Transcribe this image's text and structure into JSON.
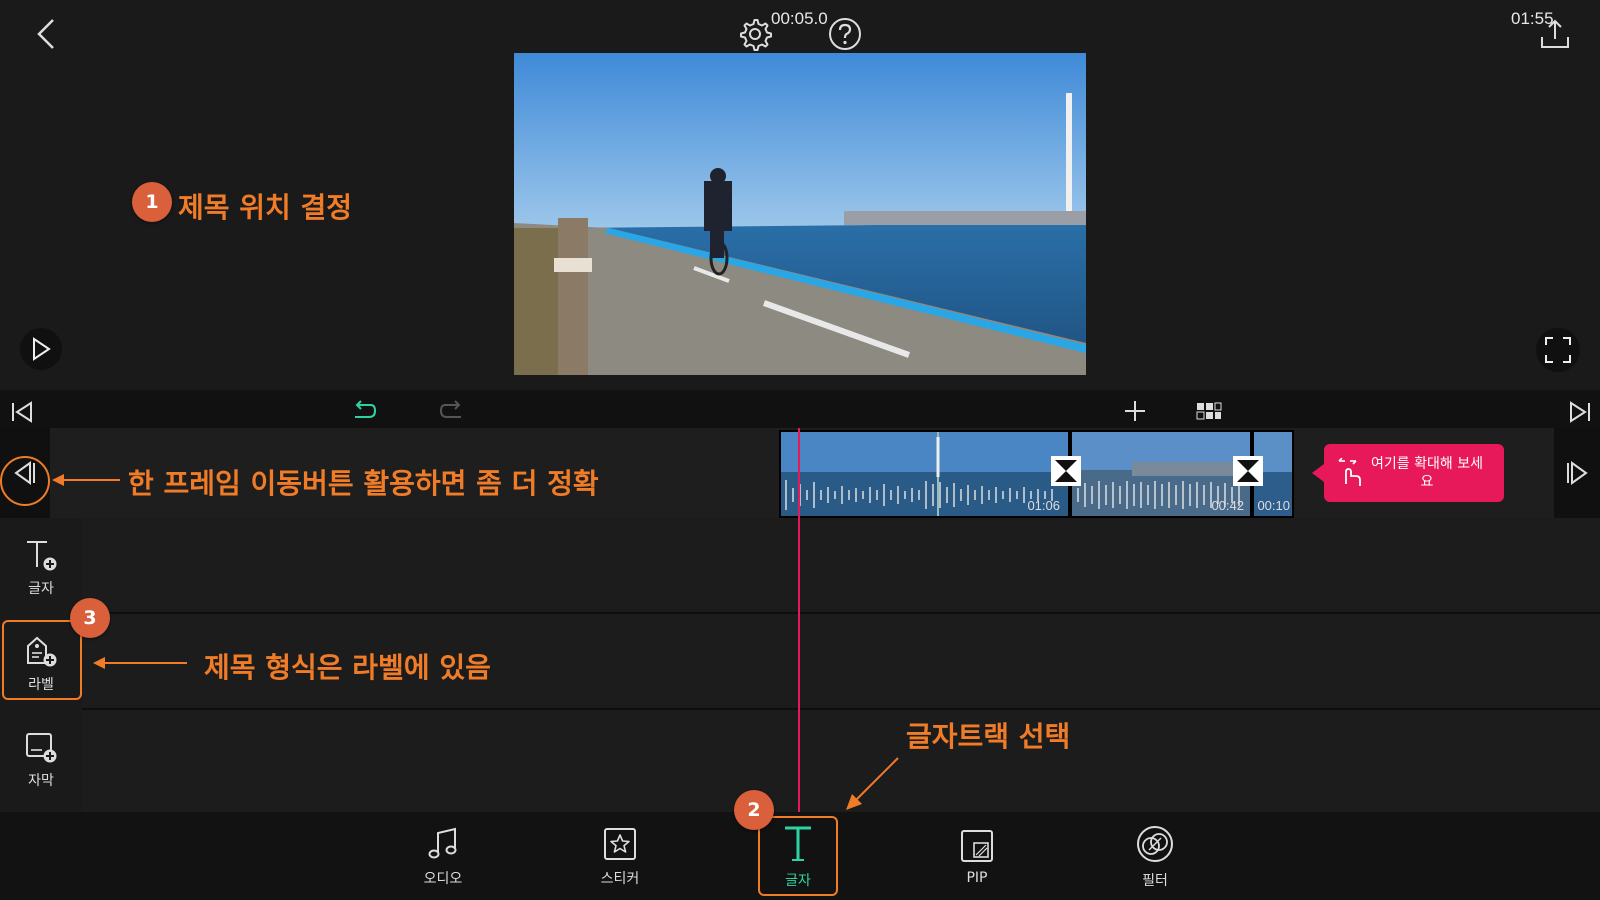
{
  "timeline": {
    "current_time": "00:05.0",
    "total_time": "01:55"
  },
  "clips": [
    {
      "duration": "01:06"
    },
    {
      "duration": "00:42"
    },
    {
      "duration": "00:10"
    }
  ],
  "zoom_hint": {
    "text": "여기를 확대해 보세요"
  },
  "side_tracks": [
    {
      "label": "글자",
      "icon": "text-add-icon"
    },
    {
      "label": "라벨",
      "icon": "label-add-icon"
    },
    {
      "label": "자막",
      "icon": "subtitle-add-icon"
    }
  ],
  "bottom_tabs": [
    {
      "label": "오디오",
      "icon": "music-note-icon"
    },
    {
      "label": "스티커",
      "icon": "sticker-star-icon"
    },
    {
      "label": "글자",
      "icon": "text-t-icon"
    },
    {
      "label": "PIP",
      "icon": "pip-icon"
    },
    {
      "label": "필터",
      "icon": "filter-icon"
    }
  ],
  "annotations": {
    "step1_badge": "1",
    "step1_text": "제목 위치 결정",
    "step2_badge": "2",
    "step2_text": "글자트랙 선택",
    "step3_badge": "3",
    "step3_text": "제목 형식은 라벨에 있음",
    "frame_tip": "한 프레임 이동버튼 활용하면 좀 더 정확"
  },
  "colors": {
    "accent_pink": "#e8195a",
    "accent_green": "#2fd3a3",
    "annotation_orange": "#f07c28",
    "badge_red": "#d9603a"
  }
}
